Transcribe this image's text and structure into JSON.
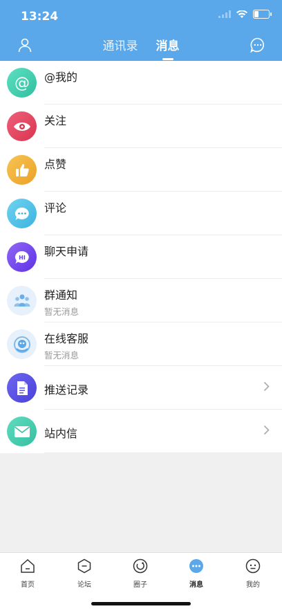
{
  "status": {
    "time": "13:24"
  },
  "header": {
    "tabs": [
      {
        "label": "通讯录"
      },
      {
        "label": "消息"
      }
    ],
    "active_tab": 1
  },
  "messages": [
    {
      "title": "@我的",
      "subtitle": "",
      "icon": "at-icon",
      "color": "#3dcfb2"
    },
    {
      "title": "关注",
      "subtitle": "",
      "icon": "eye-icon",
      "color": "#e84b64"
    },
    {
      "title": "点赞",
      "subtitle": "",
      "icon": "thumbs-up-icon",
      "color": "#f0b43a"
    },
    {
      "title": "评论",
      "subtitle": "",
      "icon": "comment-icon",
      "color": "#4fc3e8"
    },
    {
      "title": "聊天申请",
      "subtitle": "",
      "icon": "chat-request-icon",
      "color": "#7b4df0"
    },
    {
      "title": "群通知",
      "subtitle": "暂无消息",
      "icon": "group-notice-icon",
      "color": "#6aaee8"
    },
    {
      "title": "在线客服",
      "subtitle": "暂无消息",
      "icon": "customer-service-icon",
      "color": "#5ba8e6"
    },
    {
      "title": "推送记录",
      "subtitle": "",
      "icon": "document-icon",
      "color": "#5b55e8"
    },
    {
      "title": "站内信",
      "subtitle": "",
      "icon": "mail-icon",
      "color": "#4ccfb0"
    }
  ],
  "tabbar": {
    "items": [
      {
        "label": "首页",
        "icon": "home-icon"
      },
      {
        "label": "论坛",
        "icon": "forum-icon"
      },
      {
        "label": "圈子",
        "icon": "circle-icon"
      },
      {
        "label": "消息",
        "icon": "message-icon"
      },
      {
        "label": "我的",
        "icon": "profile-icon"
      }
    ],
    "active": 3
  }
}
